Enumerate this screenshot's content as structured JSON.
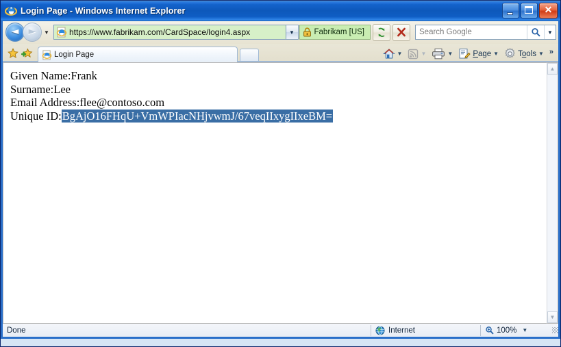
{
  "window": {
    "title": "Login Page - Windows Internet Explorer",
    "icon": "ie-logo-icon",
    "buttons": {
      "minimize": "Minimize",
      "maximize": "Maximize",
      "close": "Close"
    }
  },
  "navigation": {
    "back": "Back",
    "forward": "Forward",
    "recent_pages": "Recent Pages"
  },
  "address_bar": {
    "url": "https://www.fabrikam.com/CardSpace/login4.aspx",
    "favicon": "ie-page-icon",
    "dropdown": "Address dropdown",
    "security_badge": {
      "label": "Fabrikam [US]",
      "icon": "lock-icon",
      "background": "#c9edb2"
    },
    "background": "#d7f0c8"
  },
  "toolbar_buttons": {
    "refresh": "Refresh",
    "stop": "Stop"
  },
  "search": {
    "placeholder": "Search Google",
    "value": "",
    "go_icon": "magnifier-icon",
    "dropdown": "Search provider dropdown"
  },
  "favorites": {
    "center": "Favorites Center",
    "add": "Add to Favorites"
  },
  "tabs": [
    {
      "label": "Login Page",
      "icon": "ie-page-icon",
      "active": true
    }
  ],
  "new_tab": "New Tab",
  "command_bar": {
    "home": "Home",
    "feeds": "Feeds",
    "print": "Print",
    "page": "Page",
    "tools": "Tools",
    "overflow": "»"
  },
  "page_content": {
    "lines": [
      {
        "label": "Given Name:",
        "value": "Frank",
        "selected": false
      },
      {
        "label": "Surname:",
        "value": "Lee",
        "selected": false
      },
      {
        "label": "Email Address:",
        "value": "flee@contoso.com",
        "selected": false
      },
      {
        "label": "Unique ID:",
        "value": "BgAjO16FHqU+VmWPIacNHjvwmJ/67veqIIxygIIxeBM=",
        "selected": true
      }
    ],
    "selection_color": "#3a6ea5"
  },
  "scrollbar": {
    "up": "Scroll up",
    "down": "Scroll down"
  },
  "status_bar": {
    "message": "Done",
    "zone": "Internet",
    "zone_icon": "globe-icon",
    "zoom": "100%",
    "zoom_icon": "magnifier-icon",
    "zoom_dropdown": "Change zoom level",
    "resize_grip": "Resize"
  }
}
